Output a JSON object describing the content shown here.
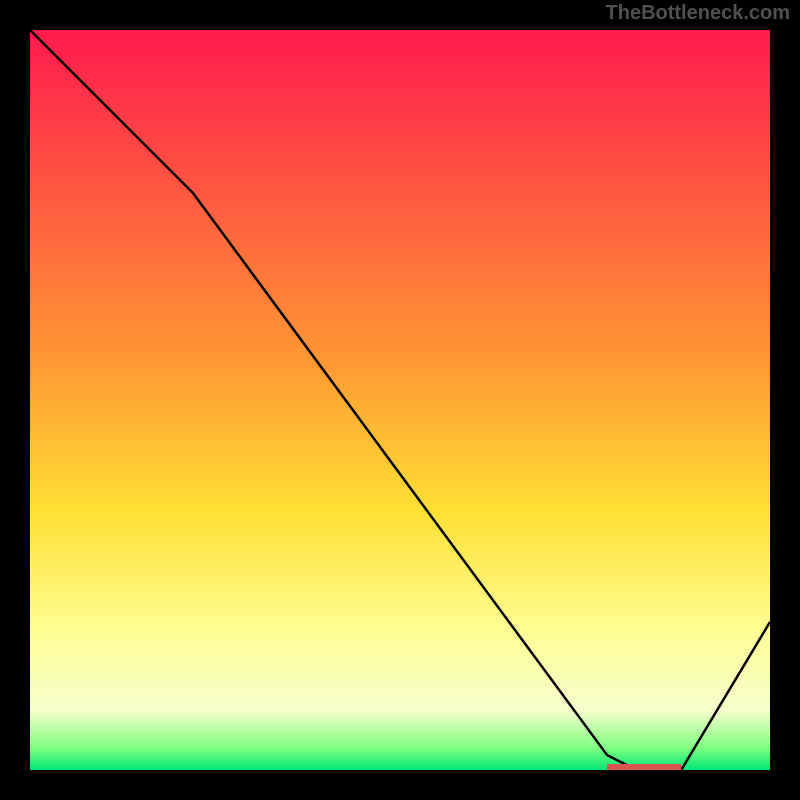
{
  "watermark": "TheBottleneck.com",
  "chart_data": {
    "type": "line",
    "title": "",
    "xlabel": "",
    "ylabel": "",
    "xlim": [
      0,
      100
    ],
    "ylim": [
      0,
      100
    ],
    "background_gradient": {
      "stops": [
        {
          "pos": 0.0,
          "color": "#ff1a4d"
        },
        {
          "pos": 0.45,
          "color": "#ff9933"
        },
        {
          "pos": 0.65,
          "color": "#ffe033"
        },
        {
          "pos": 0.82,
          "color": "#ffff99"
        },
        {
          "pos": 0.92,
          "color": "#f5ffcc"
        },
        {
          "pos": 0.97,
          "color": "#80ff80"
        },
        {
          "pos": 1.0,
          "color": "#00e676"
        }
      ]
    },
    "series": [
      {
        "name": "bottleneck-curve",
        "color": "#000000",
        "x": [
          0,
          22,
          78,
          82,
          88,
          100
        ],
        "y": [
          100,
          78,
          2,
          0,
          0,
          20
        ]
      }
    ],
    "marker": {
      "color": "#d9534f",
      "x_start": 78,
      "x_end": 88,
      "y": 0,
      "height": 1
    }
  }
}
